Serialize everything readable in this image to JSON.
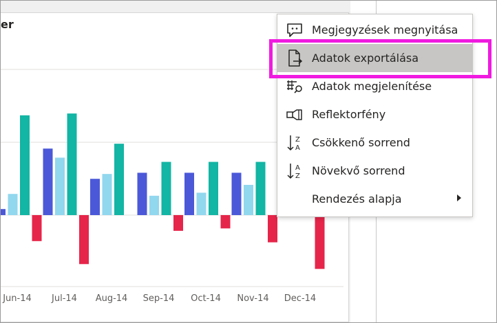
{
  "visual": {
    "title_fragment": "er"
  },
  "colors": {
    "series_1": "#4b58d8",
    "series_2": "#91d7ee",
    "series_3": "#13b5a4",
    "series_4": "#e6254a",
    "highlight_outline": "#f01ae0",
    "menu_highlight": "#c8c6c4"
  },
  "chart_data": {
    "type": "bar",
    "categories": [
      "Jun-14",
      "Jul-14",
      "Aug-14",
      "Sep-14",
      "Oct-14",
      "Nov-14",
      "Dec-14"
    ],
    "series": [
      {
        "values": [
          1,
          11,
          6,
          7,
          7,
          7,
          null
        ],
        "color": "#4b58d8"
      },
      {
        "values": [
          3.5,
          9.5,
          6.8,
          3.2,
          3.7,
          5,
          null
        ],
        "color": "#91d7ee"
      },
      {
        "values": [
          16.5,
          16.8,
          11.8,
          8.8,
          8.8,
          8.8,
          null
        ],
        "color": "#13b5a4"
      },
      {
        "values": [
          -4.3,
          -8.1,
          null,
          -2.6,
          -2.2,
          -4.5,
          -8.9
        ],
        "color": "#e6254a"
      }
    ],
    "grid": true,
    "legend": "none"
  },
  "context_menu": {
    "items": [
      {
        "label": "Megjegyzések megnyitása",
        "icon": "comment-icon"
      },
      {
        "label": "Adatok exportálása",
        "icon": "export-data-icon",
        "highlighted": true
      },
      {
        "label": "Adatok megjelenítése",
        "icon": "show-data-icon"
      },
      {
        "label": "Reflektorfény",
        "icon": "spotlight-icon"
      },
      {
        "label": "Csökkenő sorrend",
        "icon": "sort-descending-icon"
      },
      {
        "label": "Növekvő sorrend",
        "icon": "sort-ascending-icon"
      },
      {
        "label": "Rendezés alapja",
        "icon": "",
        "submenu": true
      }
    ]
  }
}
